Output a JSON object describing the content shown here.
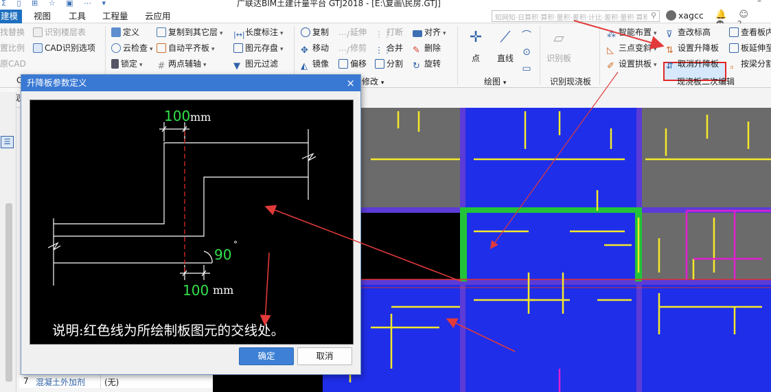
{
  "window": {
    "title": "广联达BIM土建计量平台 GTJ2018 - [E:\\复画\\民房.GTJ]",
    "quick_access_icons": "Σ ▯ ⊞ ☆ ▣ ⋯ ▾",
    "minimize": "–"
  },
  "menu": {
    "tabs": [
      "建模",
      "视图",
      "工具",
      "工程量",
      "云应用"
    ],
    "search_placeholder": "知网知·日算积·算积·量积·差积·计比·差积·量积·算积·量积",
    "user_name": "xagcc",
    "right_icons": "🔔 ☺ ☻ ?"
  },
  "ribbon": {
    "left_cut": {
      "items": [
        "找替换",
        "置比例",
        "原CAD"
      ],
      "group_label": "C"
    },
    "cad": {
      "items": [
        "识别楼层表",
        "CAD识别选项"
      ]
    },
    "general": {
      "items": [
        "定义",
        "云检查",
        "锁定",
        "复制到其它层",
        "自动平齐板",
        "两点辅轴",
        "长度标注",
        "图元存盘",
        "图元过滤"
      ]
    },
    "modify": {
      "items": [
        "复制",
        "移动",
        "镜像",
        "延伸",
        "修剪",
        "偏移",
        "打断",
        "合并",
        "分割",
        "对齐",
        "删除",
        "旋转"
      ],
      "group_label": "修改"
    },
    "draw": {
      "items": [
        "点",
        "直线"
      ],
      "group_label": "绘图"
    },
    "recognize": {
      "item": "识别板",
      "group_label": "识别现浇板"
    },
    "edit2": {
      "items": [
        "智能布置",
        "三点变斜",
        "设置拱板",
        "查改标高",
        "设置升降板",
        "取消升降板",
        "查看板内",
        "板延伸至",
        "按梁分割"
      ],
      "group_label": "现浇板二次编辑"
    }
  },
  "dialog": {
    "title": "升降板参数定义",
    "close_icon": "×",
    "diagram": {
      "top_dim": "100",
      "bottom_dim": "100",
      "unit": "mm",
      "angle": "90",
      "angle_unit": "°",
      "note": "说明:红色线为所绘制板图元的交线处。"
    },
    "ok": "确定",
    "cancel": "取消"
  },
  "property_panel": {
    "row": {
      "index": "7",
      "name": "混凝土外加剂",
      "value": "(无)"
    },
    "side_tab": "现"
  }
}
